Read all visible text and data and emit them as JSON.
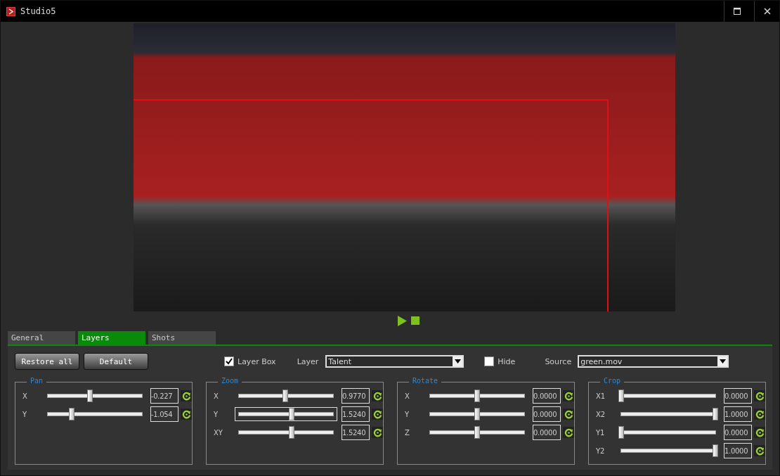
{
  "window": {
    "title": "Studio5"
  },
  "preview": {
    "layer_box": true
  },
  "transport": {
    "playing": false
  },
  "tabs": [
    {
      "label": "General",
      "selected": false
    },
    {
      "label": "Layers",
      "selected": true
    },
    {
      "label": "Shots",
      "selected": false
    }
  ],
  "buttons": [
    "Restore all",
    "Default"
  ],
  "layer_box": {
    "label": "Layer Box",
    "checked": true
  },
  "layer": {
    "label": "Layer",
    "value": "Talent"
  },
  "hide": {
    "label": "Hide",
    "checked": false
  },
  "source": {
    "label": "Source",
    "value": "green.mov"
  },
  "groups": [
    {
      "title": "Pan",
      "rows": [
        {
          "label": "X",
          "level": 0.45,
          "value": "-0.227",
          "focused": false
        },
        {
          "label": "Y",
          "level": 0.25,
          "value": "-1.054",
          "focused": false
        }
      ]
    },
    {
      "title": "Zoom",
      "rows": [
        {
          "label": "X",
          "level": 0.49,
          "value": "0.9770",
          "focused": false
        },
        {
          "label": "Y",
          "level": 0.56,
          "value": "1.5240",
          "focused": true
        },
        {
          "label": "XY",
          "level": 0.56,
          "value": "1.5240",
          "focused": false
        }
      ]
    },
    {
      "title": "Rotate",
      "rows": [
        {
          "label": "X",
          "level": 0.5,
          "value": "0.0000",
          "focused": false
        },
        {
          "label": "Y",
          "level": 0.5,
          "value": "0.0000",
          "focused": false
        },
        {
          "label": "Z",
          "level": 0.5,
          "value": "0.0000",
          "focused": false
        }
      ]
    },
    {
      "title": "Crop",
      "rows": [
        {
          "label": "X1",
          "level": 0,
          "value": "0.0000",
          "focused": false
        },
        {
          "label": "X2",
          "level": 1,
          "value": "1.0000",
          "focused": false
        },
        {
          "label": "Y1",
          "level": 0,
          "value": "0.0000",
          "focused": false
        },
        {
          "label": "Y2",
          "level": 1,
          "value": "1.0000",
          "focused": false
        }
      ]
    }
  ]
}
